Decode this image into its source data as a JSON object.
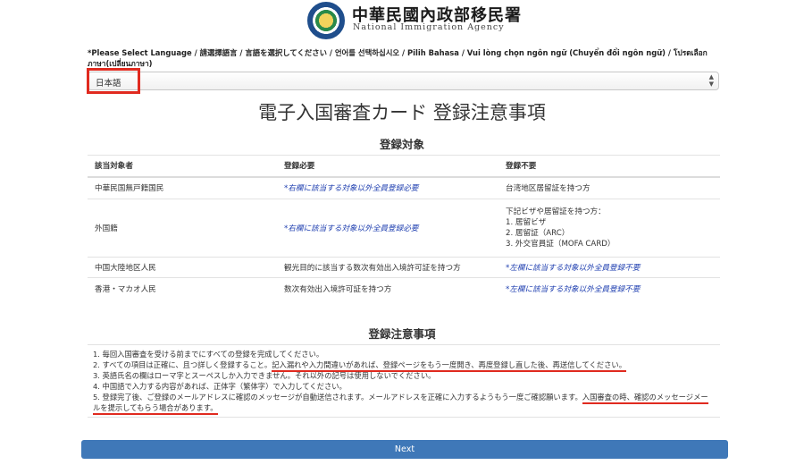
{
  "header": {
    "agency_zh": "中華民國內政部移民署",
    "agency_en": "National Immigration Agency"
  },
  "language": {
    "label": "*Please Select Language / 請選擇語言 / 言語を選択してください / 언어를 선택하십시오 / Pilih Bahasa / Vui lòng chọn ngôn ngữ (Chuyển đổi ngôn ngữ) / โปรดเลือกภาษา(เปลี่ยนภาษา)",
    "selected": "日本語"
  },
  "page_title": "電子入国審査カード 登録注意事項",
  "registration": {
    "title": "登録対象",
    "headers": [
      "該当対象者",
      "登録必要",
      "登録不要"
    ],
    "rows": [
      {
        "target": "中華民国無戸籍国民",
        "required": "*右欄に該当する対象以外全員登録必要",
        "not_required": "台湾地区居留証を持つ方"
      },
      {
        "target": "外国籍",
        "required": "*右欄に該当する対象以外全員登録必要",
        "not_required_lines": [
          "下記ビザや居留証を持つ方：",
          "1. 居留ビザ",
          "2. 居留証（ARC）",
          "3. 外交官員証（MOFA CARD）"
        ]
      },
      {
        "target": "中国大陸地区人民",
        "required": "観光目的に該当する数次有効出入境許可証を持つ方",
        "not_required": "*左欄に該当する対象以外全員登録不要"
      },
      {
        "target": "香港・マカオ人民",
        "required": "数次有効出入境許可証を持つ方",
        "not_required": "*左欄に該当する対象以外全員登録不要"
      }
    ]
  },
  "notes": {
    "title": "登録注意事項",
    "n1": "1. 毎回入国審査を受ける前までにすべての登録を完成してください。",
    "n2_a": "2. すべての項目は正確に、且つ詳しく登録すること。",
    "n2_b": "記入漏れや入力間違いがあれば、登録ページをもう一度開き、再度登録し直した後、再送信してください。",
    "n3": "3. 英語氏名の欄はローマ字とスーペスしか入力できません。それ以外の記号は使用しないでください。",
    "n4": "4. 中国語で入力する内容があれば、正体字（繁体字）で入力してください。",
    "n5_a": "5. 登録完了後、ご登録のメールアドレスに確認のメッセージが自動送信されます。メールアドレスを正確に入力するようもう一度ご確認願います。",
    "n5_b": "入国審査の時、確認のメッセージメールを提示してもらう場合があります。"
  },
  "next_label": "Next",
  "colors": {
    "highlight": "#e02a1f",
    "note_blue": "#1f3fb0",
    "button": "#3f78b8"
  }
}
